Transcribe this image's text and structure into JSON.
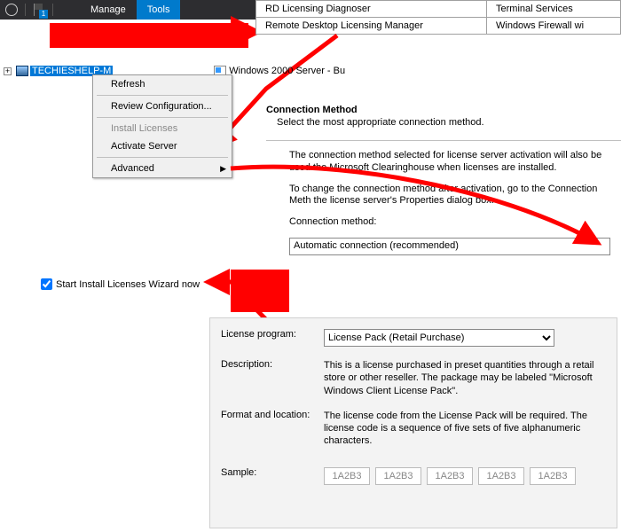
{
  "menubar": {
    "flag_badge": "1",
    "manage": "Manage",
    "tools": "Tools"
  },
  "toolsMenu": {
    "rd_diag": "RD Licensing Diagnoser",
    "rd_mgr": "Remote Desktop Licensing Manager",
    "term_svc": "Terminal Services",
    "win_fw": "Windows Firewall wi"
  },
  "tree": {
    "node": "TECHIESHELP-M",
    "child": "Windows 2000 Server - Bu"
  },
  "ctx": {
    "refresh": "Refresh",
    "review": "Review Configuration...",
    "install": "Install Licenses",
    "activate": "Activate Server",
    "advanced": "Advanced"
  },
  "wiz": {
    "title": "Connection Method",
    "subtitle": "Select the most appropriate connection method.",
    "p1": "The connection method selected for license server activation will also be used the Microsoft Clearinghouse when licenses are installed.",
    "p2": "To change the connection method after activation, go to the Connection Meth the license server's Properties dialog box.",
    "label": "Connection method:",
    "value": "Automatic connection (recommended)"
  },
  "chk": {
    "label": "Start Install Licenses Wizard now"
  },
  "lic": {
    "prog_label": "License program:",
    "prog_value": "License Pack (Retail Purchase)",
    "desc_label": "Description:",
    "desc_value": "This is a license purchased in preset quantities through a retail store or other reseller. The package may be labeled \"Microsoft Windows Client License Pack\".",
    "fmt_label": "Format and location:",
    "fmt_value": "The license code from the License Pack will be required. The license code is a sequence of five sets of five alphanumeric characters.",
    "sample_label": "Sample:",
    "sample": "1A2B3"
  }
}
